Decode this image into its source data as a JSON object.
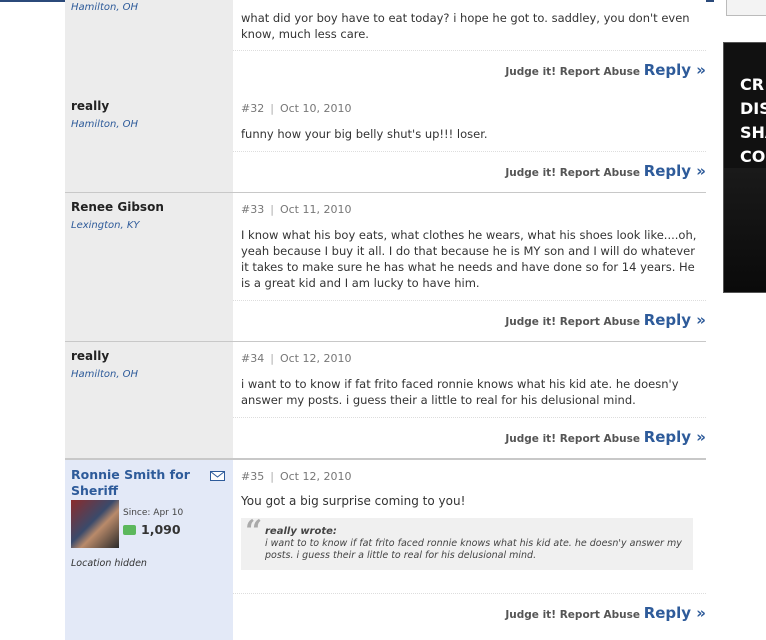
{
  "ad": {
    "lines": [
      "CR",
      "DIS",
      "SHA",
      "CO"
    ]
  },
  "actions": {
    "judge": "Judge it!",
    "report": "Report Abuse",
    "reply": "Reply »"
  },
  "posts": [
    {
      "user": "",
      "location": "Hamilton, OH",
      "number": "",
      "date": "",
      "text": "what did yor boy have to eat today? i hope he got to. saddley, you don't even know, much less care."
    },
    {
      "user": "really",
      "location": "Hamilton, OH",
      "number": "#32",
      "date": "Oct 10, 2010",
      "text": "funny how your big belly shut's up!!! loser."
    },
    {
      "user": "Renee Gibson",
      "location": "Lexington, KY",
      "number": "#33",
      "date": "Oct 11, 2010",
      "text": "I know what his boy eats, what clothes he wears, what his shoes look like....oh, yeah because I buy it all. I do that because he is MY son and I will do whatever it takes to make sure he has what he needs and have done so for 14 years. He is a great kid and I am lucky to have him."
    },
    {
      "user": "really",
      "location": "Hamilton, OH",
      "number": "#34",
      "date": "Oct 12, 2010",
      "text": "i want to to know if fat frito faced ronnie knows what his kid ate. he doesn'y answer my posts. i guess their a little to real for his delusional mind."
    },
    {
      "user": "Ronnie Smith for Sheriff",
      "since": "Since: Apr 10",
      "points": "1,090",
      "location": "Location hidden",
      "number": "#35",
      "date": "Oct 12, 2010",
      "text": "You got a big surprise coming to you!",
      "quote": {
        "author": "really wrote:",
        "text": "i want to to know if fat frito faced ronnie knows what his kid ate. he doesn'y answer my posts. i guess their a little to real for his delusional mind."
      }
    }
  ]
}
